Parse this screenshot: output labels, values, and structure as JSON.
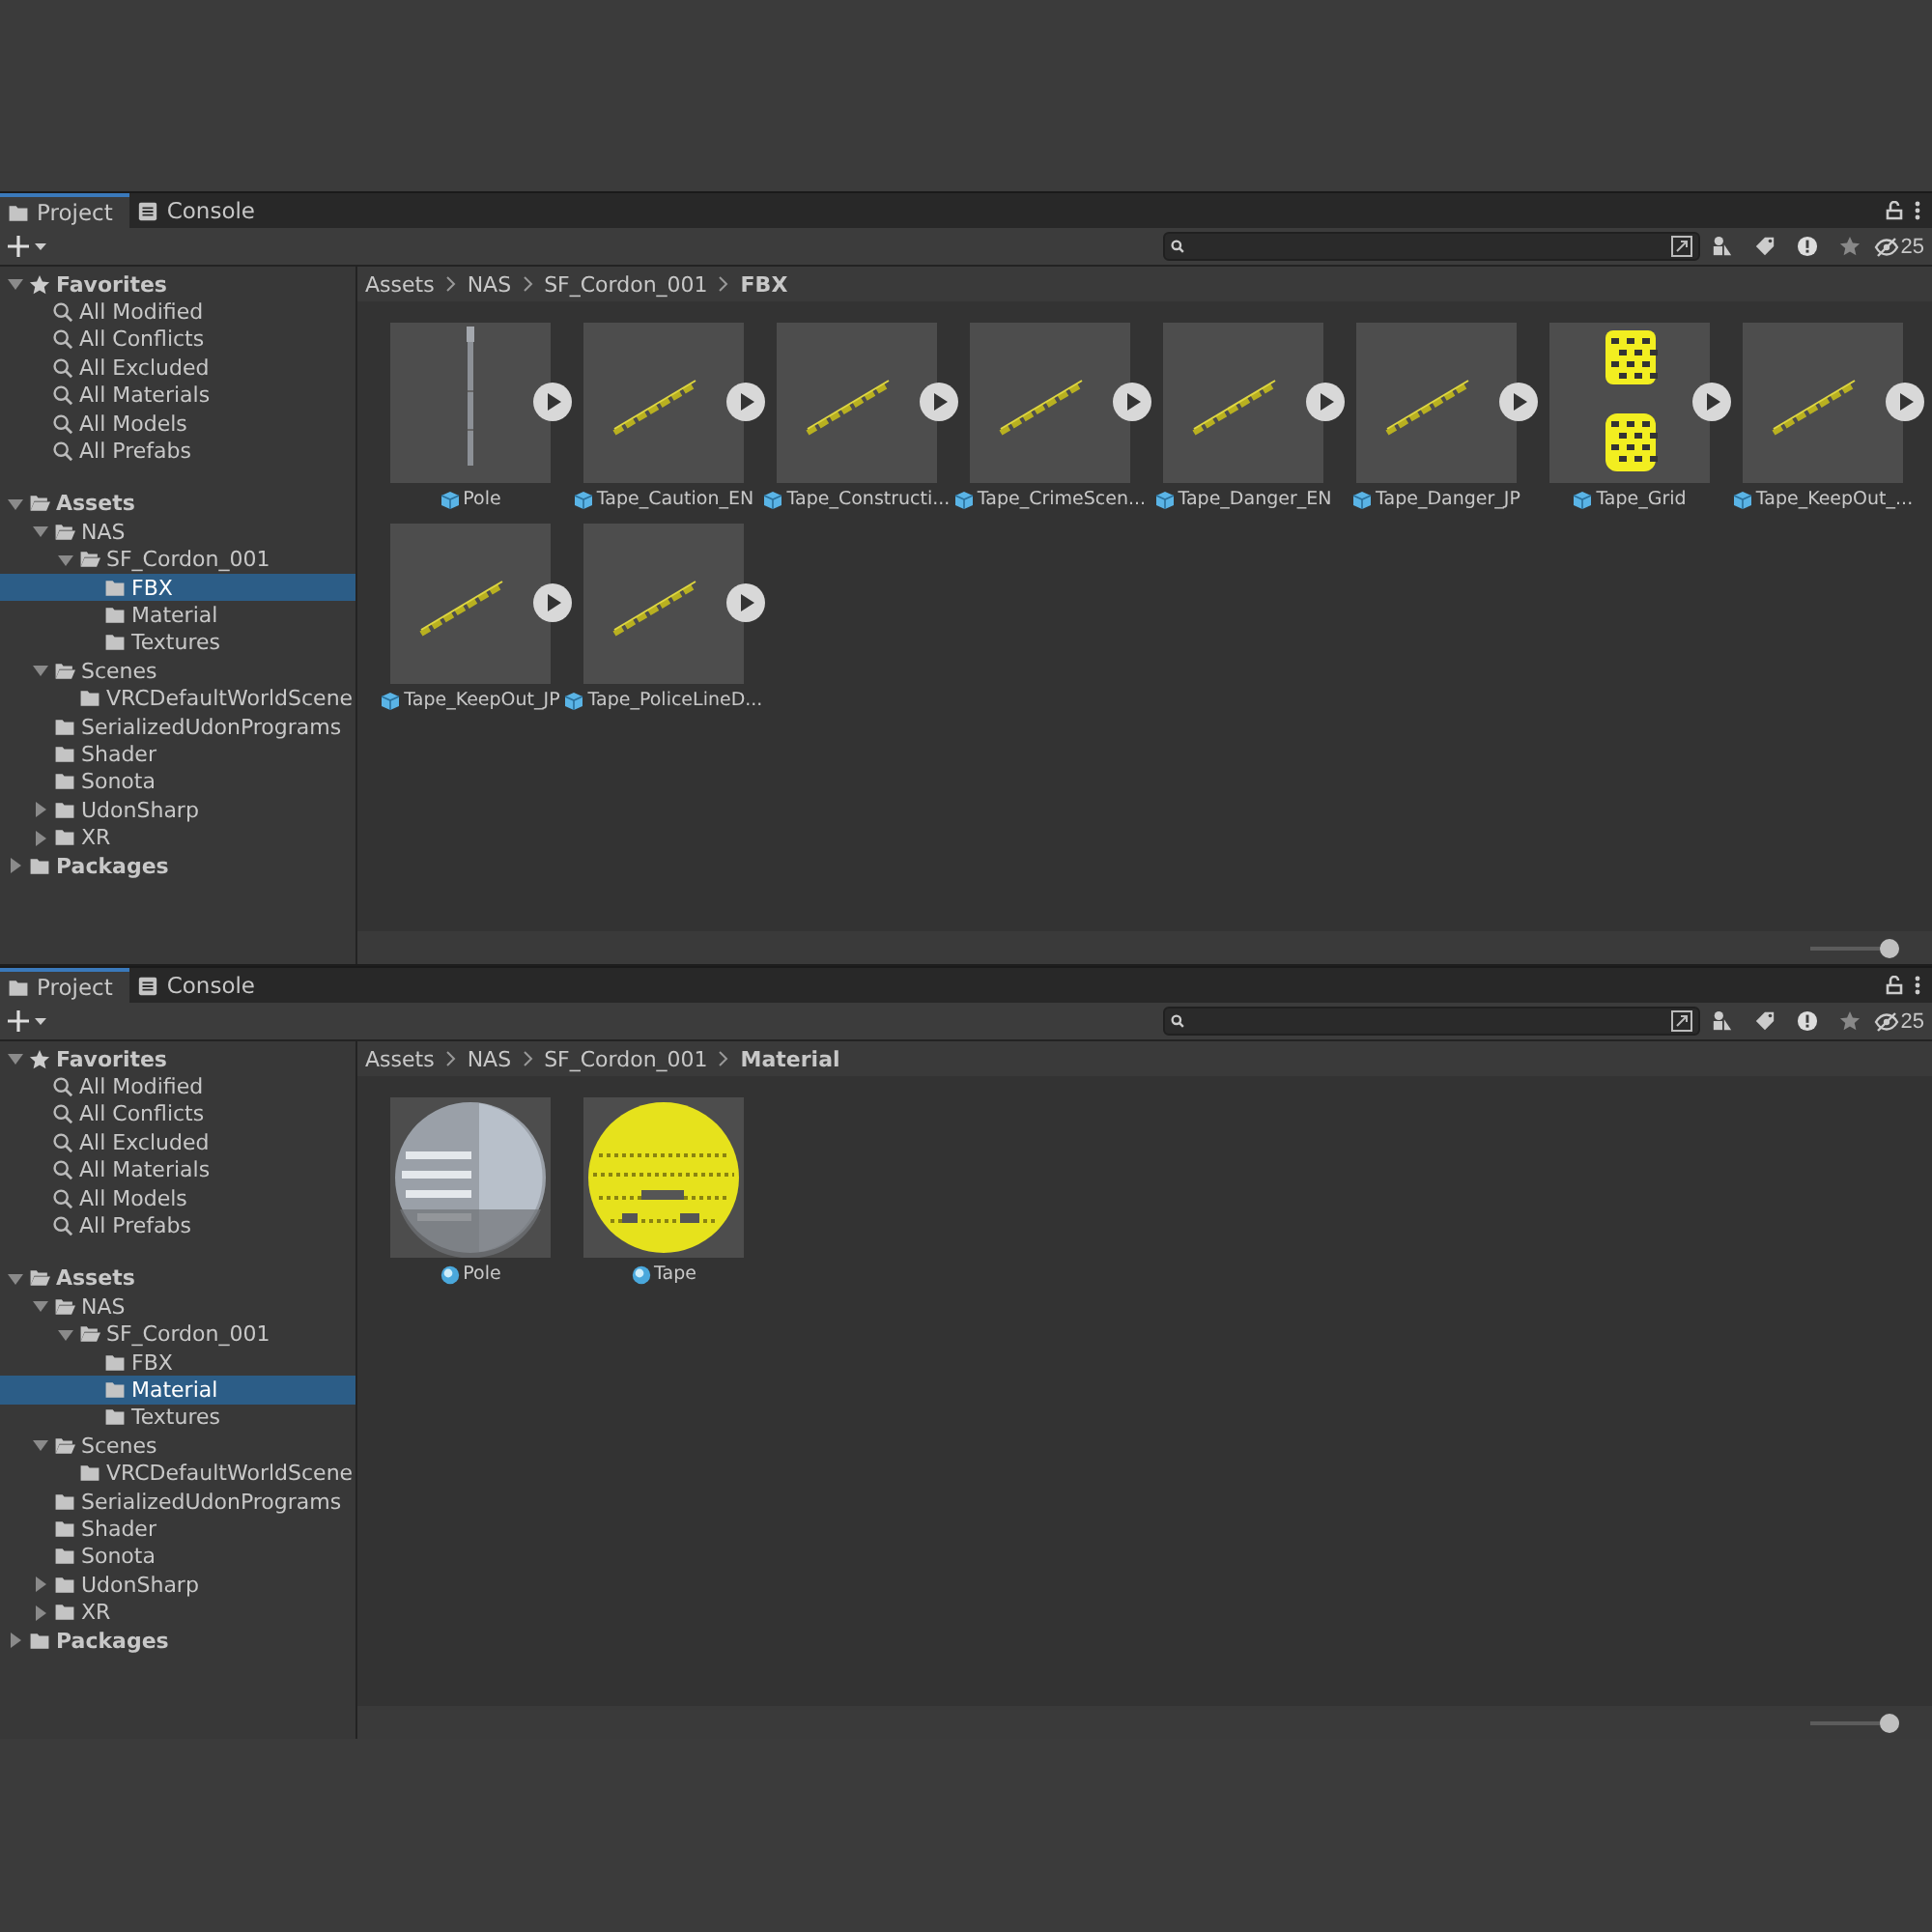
{
  "panels": [
    {
      "tabs": [
        {
          "label": "Project",
          "selected": true
        },
        {
          "label": "Console",
          "selected": false
        }
      ],
      "hidden_count": "25",
      "favorites": {
        "label": "Favorites",
        "expanded": true,
        "items": [
          "All Modified",
          "All Conflicts",
          "All Excluded",
          "All Materials",
          "All Models",
          "All Prefabs"
        ]
      },
      "tree": [
        {
          "label": "Assets",
          "expanded": true,
          "selected": false,
          "children": [
            {
              "label": "NAS",
              "expanded": true,
              "selected": false,
              "children": [
                {
                  "label": "SF_Cordon_001",
                  "expanded": true,
                  "selected": false,
                  "children": [
                    {
                      "label": "FBX",
                      "selected": true
                    },
                    {
                      "label": "Material",
                      "selected": false
                    },
                    {
                      "label": "Textures",
                      "selected": false
                    }
                  ]
                }
              ]
            },
            {
              "label": "Scenes",
              "expanded": true,
              "selected": false,
              "children": [
                {
                  "label": "VRCDefaultWorldScene",
                  "selected": false
                }
              ]
            },
            {
              "label": "SerializedUdonPrograms",
              "selected": false
            },
            {
              "label": "Shader",
              "selected": false
            },
            {
              "label": "Sonota",
              "selected": false
            },
            {
              "label": "UdonSharp",
              "expanded": false,
              "selected": false
            },
            {
              "label": "XR",
              "expanded": false,
              "selected": false
            }
          ]
        },
        {
          "label": "Packages",
          "expanded": false,
          "selected": false
        }
      ],
      "breadcrumb": [
        "Assets",
        "NAS",
        "SF_Cordon_001",
        "FBX"
      ],
      "assets": [
        {
          "name": "Pole",
          "kind": "pole_model"
        },
        {
          "name": "Tape_Caution_EN",
          "kind": "tape_model"
        },
        {
          "name": "Tape_Constructi...",
          "kind": "tape_model"
        },
        {
          "name": "Tape_CrimeScen...",
          "kind": "tape_model"
        },
        {
          "name": "Tape_Danger_EN",
          "kind": "tape_model"
        },
        {
          "name": "Tape_Danger_JP",
          "kind": "tape_model"
        },
        {
          "name": "Tape_Grid",
          "kind": "grid_model"
        },
        {
          "name": "Tape_KeepOut_...",
          "kind": "tape_model"
        },
        {
          "name": "Tape_KeepOut_JP",
          "kind": "tape_model"
        },
        {
          "name": "Tape_PoliceLineD...",
          "kind": "tape_model"
        }
      ],
      "zoom_slider": {
        "level": 1
      }
    },
    {
      "tabs": [
        {
          "label": "Project",
          "selected": true
        },
        {
          "label": "Console",
          "selected": false
        }
      ],
      "hidden_count": "25",
      "favorites": {
        "label": "Favorites",
        "expanded": true,
        "items": [
          "All Modified",
          "All Conflicts",
          "All Excluded",
          "All Materials",
          "All Models",
          "All Prefabs"
        ]
      },
      "tree": [
        {
          "label": "Assets",
          "expanded": true,
          "selected": false,
          "children": [
            {
              "label": "NAS",
              "expanded": true,
              "selected": false,
              "children": [
                {
                  "label": "SF_Cordon_001",
                  "expanded": true,
                  "selected": false,
                  "children": [
                    {
                      "label": "FBX",
                      "selected": false
                    },
                    {
                      "label": "Material",
                      "selected": true
                    },
                    {
                      "label": "Textures",
                      "selected": false
                    }
                  ]
                }
              ]
            },
            {
              "label": "Scenes",
              "expanded": true,
              "selected": false,
              "children": [
                {
                  "label": "VRCDefaultWorldScene",
                  "selected": false
                }
              ]
            },
            {
              "label": "SerializedUdonPrograms",
              "selected": false
            },
            {
              "label": "Shader",
              "selected": false
            },
            {
              "label": "Sonota",
              "selected": false
            },
            {
              "label": "UdonSharp",
              "expanded": false,
              "selected": false
            },
            {
              "label": "XR",
              "expanded": false,
              "selected": false
            }
          ]
        },
        {
          "label": "Packages",
          "expanded": false,
          "selected": false
        }
      ],
      "breadcrumb": [
        "Assets",
        "NAS",
        "SF_Cordon_001",
        "Material"
      ],
      "assets": [
        {
          "name": "Pole",
          "kind": "pole_material"
        },
        {
          "name": "Tape",
          "kind": "tape_material"
        }
      ],
      "zoom_slider": {
        "level": 1
      }
    }
  ]
}
